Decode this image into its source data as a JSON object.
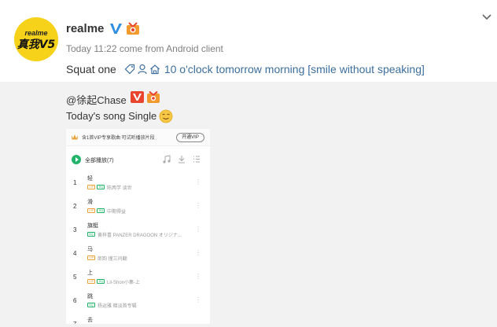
{
  "post": {
    "username": "realme",
    "avatar_text_top": "realme",
    "avatar_text_main": "真我V5",
    "meta": "Today 11:22 come from Android client",
    "text_plain": "Squat one",
    "text_link": "10 o'clock tomorrow morning [smile without speaking]"
  },
  "repost": {
    "user": "@徐起Chase",
    "text": "Today's song Single"
  },
  "music": {
    "vip_banner": "含1首VIP专享歌曲 可试听播放片段",
    "vip_button": "开通VIP",
    "play_all": "全部播放(7)",
    "songs": [
      {
        "num": "1",
        "title": "轻",
        "artist": "陈两学 谈世",
        "tags": [
          "orange",
          "green"
        ]
      },
      {
        "num": "2",
        "title": "滑",
        "artist": "中期得益",
        "tags": [
          "orange",
          "green"
        ]
      },
      {
        "num": "3",
        "title": "旗艇",
        "artist": "黄梓喜 PANZER DRAGOON オリジナ...",
        "tags": [
          "green"
        ]
      },
      {
        "num": "4",
        "title": "马",
        "artist": "郎韵 撞三问翻",
        "tags": [
          "orange"
        ]
      },
      {
        "num": "5",
        "title": "上",
        "artist": "Lil-Shon小集-上",
        "tags": [
          "orange",
          "green"
        ]
      },
      {
        "num": "6",
        "title": "跳",
        "artist": "杨运雅 暗淡首专辑",
        "tags": [
          "green"
        ]
      },
      {
        "num": "7",
        "title": "去",
        "artist": "",
        "tags": []
      }
    ]
  },
  "colors": {
    "link": "#3c6e9e",
    "vip_orange": "#e8a43a",
    "play_green": "#22b46b",
    "verified_blue": "#2f8fe0"
  }
}
